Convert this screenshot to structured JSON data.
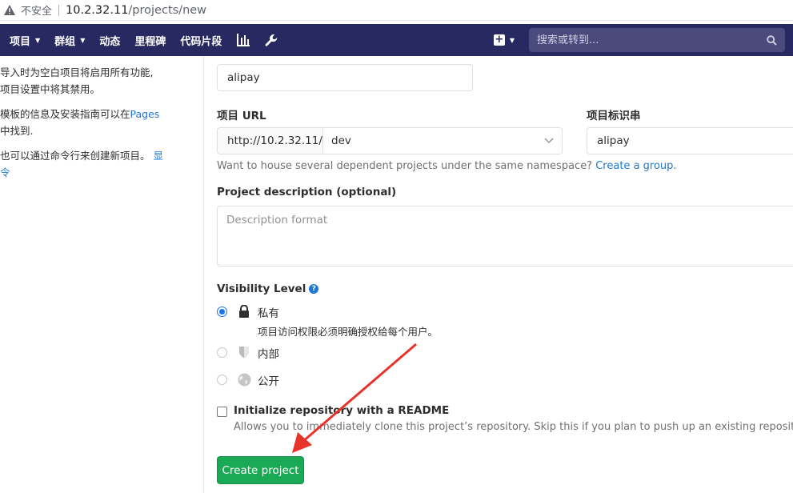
{
  "browser": {
    "security_label": "不安全",
    "url_host": "10.2.32.11",
    "url_path": "/projects/new"
  },
  "navbar": {
    "items": [
      {
        "label": "项目",
        "caret": true
      },
      {
        "label": "群组",
        "caret": true
      },
      {
        "label": "动态",
        "caret": false
      },
      {
        "label": "里程碑",
        "caret": false
      },
      {
        "label": "代码片段",
        "caret": false
      }
    ],
    "search_placeholder": "搜索或转到..."
  },
  "left_info": {
    "p1_line1": "导入时为空白项目将启用所有功能,",
    "p1_line2": "项目设置中将其禁用。",
    "p2_text": "模板的信息及安装指南可以在",
    "p2_link": "Pages",
    "p2_line2": "中找到.",
    "p3_text": "也可以通过命令行来创建新项目。",
    "p3_link": "显",
    "p3_line2": "令"
  },
  "form": {
    "project_name_value": "alipay",
    "url_label": "项目 URL",
    "url_prefix": "http://10.2.32.11/",
    "namespace_value": "dev",
    "slug_label": "项目标识串",
    "slug_value": "alipay",
    "help_text": "Want to house several dependent projects under the same namespace?",
    "help_link": "Create a group.",
    "description_label": "Project description (optional)",
    "description_placeholder": "Description format",
    "visibility_label": "Visibility Level",
    "visibility_options": [
      {
        "title": "私有",
        "desc": "项目访问权限必须明确授权给每个用户。",
        "checked": true,
        "icon": "lock-icon"
      },
      {
        "title": "内部",
        "desc": "",
        "checked": false,
        "icon": "shield-icon"
      },
      {
        "title": "公开",
        "desc": "",
        "checked": false,
        "icon": "globe-icon"
      }
    ],
    "readme_label": "Initialize repository with a README",
    "readme_desc": "Allows you to immediately clone this project’s repository. Skip this if you plan to push up an existing repository.",
    "create_button": "Create project"
  },
  "colors": {
    "navbar": "#292961",
    "primary_button": "#1aaa55",
    "link": "#1f78d1",
    "annotation_arrow": "#e8332a"
  }
}
